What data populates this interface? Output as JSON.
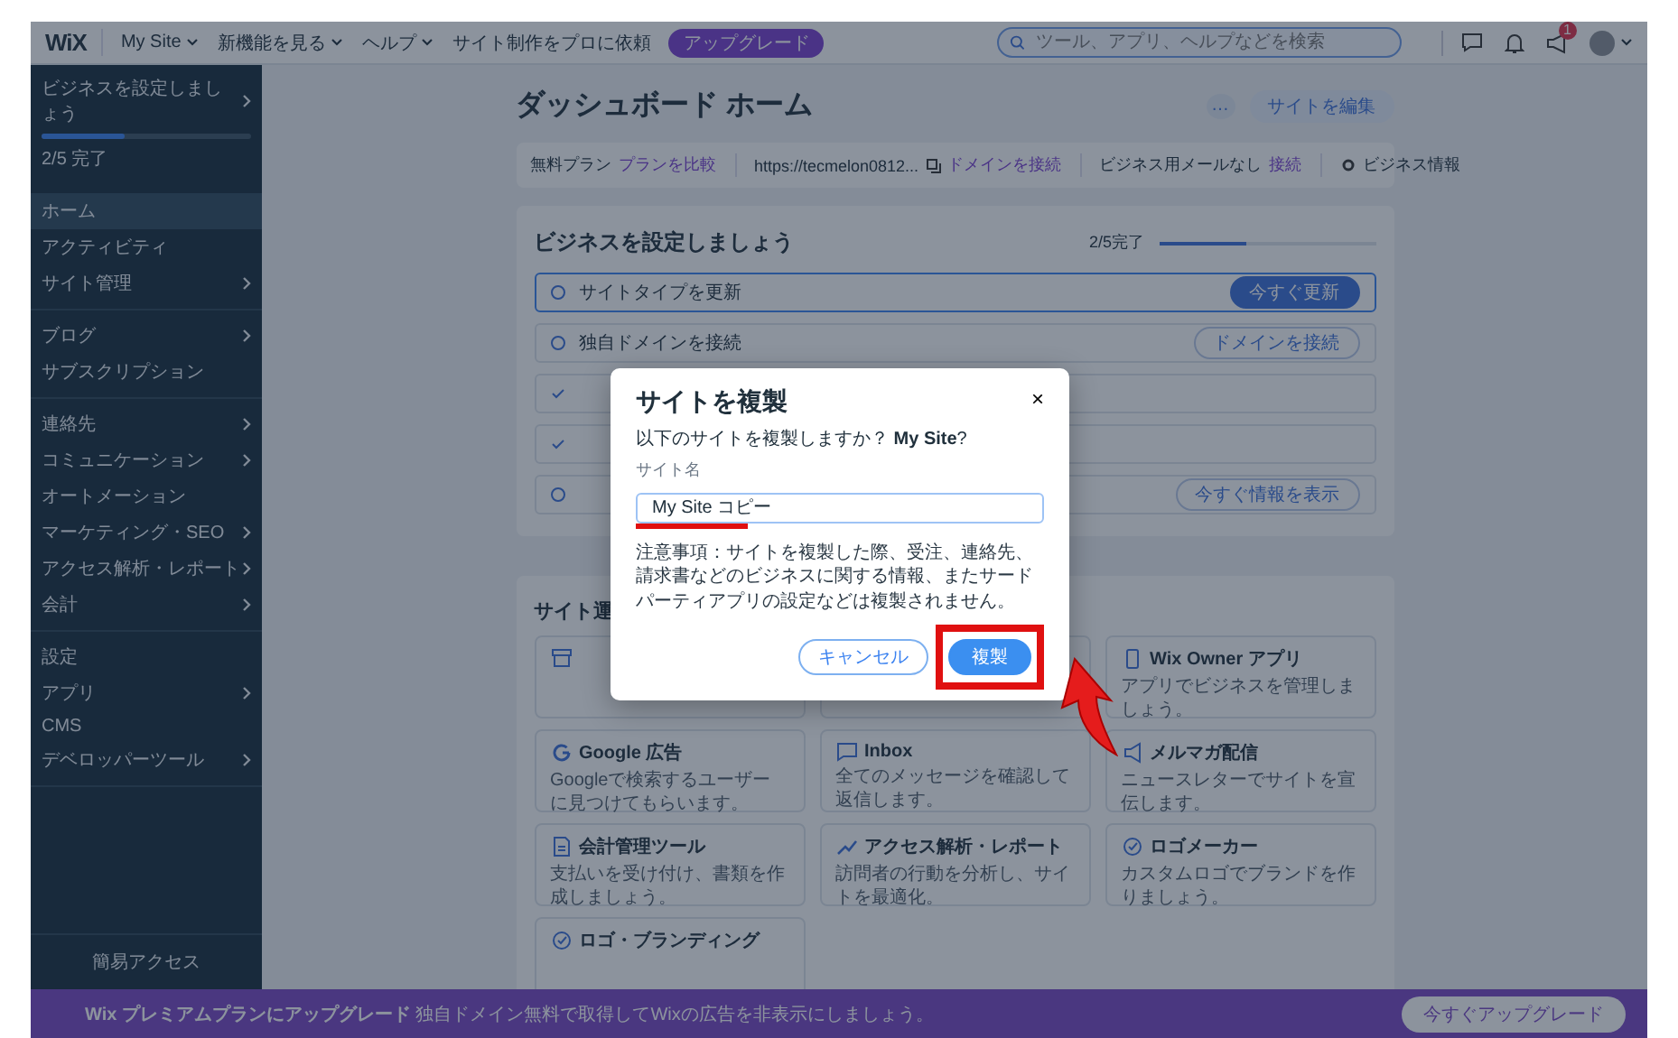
{
  "top_bar": {
    "logo": "WiX",
    "site_menu": "My Site",
    "menus": [
      "新機能を見る",
      "ヘルプ"
    ],
    "hire_link": "サイト制作をプロに依頼",
    "upgrade_badge": "アップグレード",
    "search": {
      "placeholder": "ツール、アプリ、ヘルプなどを検索"
    },
    "cart_badge": "1"
  },
  "sidebar": {
    "setup": {
      "title": "ビジネスを設定しましょう",
      "level": 0.4,
      "progress": "2/5 完了"
    },
    "groups": [
      [
        {
          "label": "ホーム",
          "selected": true,
          "submenu": false
        },
        {
          "label": "アクティビティ",
          "selected": false,
          "submenu": false
        },
        {
          "label": "サイト管理",
          "selected": false,
          "submenu": true
        }
      ],
      [
        {
          "label": "ブログ",
          "selected": false,
          "submenu": true
        },
        {
          "label": "サブスクリプション",
          "selected": false,
          "submenu": false
        }
      ],
      [
        {
          "label": "連絡先",
          "selected": false,
          "submenu": true
        },
        {
          "label": "コミュニケーション",
          "selected": false,
          "submenu": true
        },
        {
          "label": "オートメーション",
          "selected": false,
          "submenu": false
        },
        {
          "label": "マーケティング・SEO",
          "selected": false,
          "submenu": true
        },
        {
          "label": "アクセス解析・レポート",
          "selected": false,
          "submenu": true
        },
        {
          "label": "会計",
          "selected": false,
          "submenu": true
        }
      ],
      [
        {
          "label": "設定",
          "selected": false,
          "submenu": false
        },
        {
          "label": "アプリ",
          "selected": false,
          "submenu": true
        },
        {
          "label": "CMS",
          "selected": false,
          "submenu": false
        },
        {
          "label": "デベロッパーツール",
          "selected": false,
          "submenu": true
        }
      ]
    ],
    "footer": "簡易アクセス"
  },
  "dashboard": {
    "title": "ダッシュボード ホーム",
    "more_button": "…",
    "edit_button": "サイトを編集",
    "info_bar": [
      {
        "kind": "plan",
        "text": "無料プラン",
        "link": "プランを比較"
      },
      {
        "kind": "url",
        "text": "https://tecmelon0812...",
        "link": "ドメインを接続"
      },
      {
        "kind": "email",
        "text": "ビジネス用メールなし",
        "link": "接続"
      },
      {
        "kind": "info",
        "text": "ビジネス情報"
      }
    ]
  },
  "setup_card": {
    "title": "ビジネスを設定しましょう",
    "progress": "2/5完了",
    "level": 0.4,
    "steps": [
      {
        "label": "サイトタイプを更新",
        "done": false,
        "selected": true,
        "button": "今すぐ更新"
      },
      {
        "label": "独自ドメインを接続",
        "done": false,
        "selected": false,
        "button": "ドメインを接続"
      },
      {
        "done": true,
        "selected": false
      },
      {
        "done": true,
        "selected": false
      },
      {
        "done": false,
        "selected": false,
        "button": "今すぐ情報を表示"
      }
    ]
  },
  "tools_section": {
    "title": "サイト運",
    "tools": [
      {
        "kind": "covered"
      },
      {
        "kind": "covered"
      },
      {
        "kind": "tool",
        "title": "Wix Owner アプリ",
        "text": "アプリでビジネスを管理しましょう。"
      },
      {
        "kind": "tool",
        "title": "Google 広告",
        "text": "Googleで検索するユーザーに見つけてもらいます。"
      },
      {
        "kind": "tool",
        "title": "Inbox",
        "text": "全てのメッセージを確認して返信します。"
      },
      {
        "kind": "tool",
        "title": "メルマガ配信",
        "text": "ニュースレターでサイトを宣伝します。"
      },
      {
        "kind": "tool",
        "title": "会計管理ツール",
        "text": "支払いを受け付け、書類を作成しましょう。"
      },
      {
        "kind": "tool",
        "title": "アクセス解析・レポート",
        "text": "訪問者の行動を分析し、サイトを最適化。"
      },
      {
        "kind": "tool",
        "title": "ロゴメーカー",
        "text": "カスタムロゴでブランドを作りましょう。"
      },
      {
        "kind": "tool",
        "title": "ロゴ・ブランディング"
      }
    ]
  },
  "bottom_banner": {
    "text": "**Wix プレミアムプランにアップグレード** 独自ドメイン無料で取得してWixの広告を非表示にしましょう。",
    "button": "今すぐアップグレード"
  },
  "dialog": {
    "title": "サイトを複製",
    "close": "×",
    "question": "以下のサイトを複製しますか？ **My Site**?",
    "field_label": "サイト名",
    "field_value": "My Site コピー",
    "note": "注意事項：サイトを複製した際、受注、連絡先、請求書などのビジネスに関する情報、またサードパーティアプリの設定などは複製されません。",
    "buttons": [
      {
        "kind": "secondary",
        "label": "キャンセル"
      },
      {
        "kind": "primary",
        "label": "複製"
      }
    ]
  }
}
